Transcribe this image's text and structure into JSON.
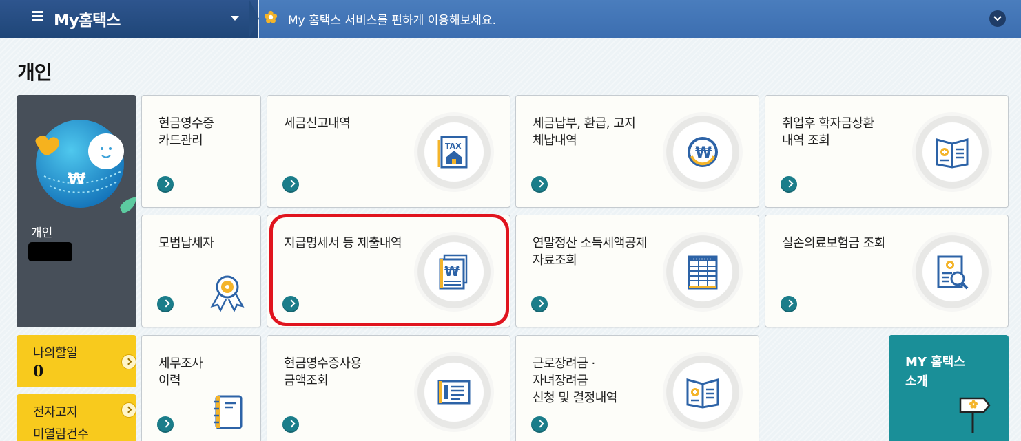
{
  "topbar": {
    "brand": "My홈택스",
    "message": "My 홈택스 서비스를 편하게 이용해보세요."
  },
  "section_title": "개인",
  "profile": {
    "label": "개인"
  },
  "tiles": [
    {
      "label": "현금영수증\n카드관리",
      "icon": "none"
    },
    {
      "label": "세금신고내역",
      "icon": "tax-house-icon"
    },
    {
      "label": "세금납부, 환급, 고지\n체납내역",
      "icon": "won-coin-icon"
    },
    {
      "label": "취업후 학자금상환\n내역 조회",
      "icon": "open-book-icon"
    },
    {
      "label": "모범납세자",
      "icon": "award-ribbon-icon"
    },
    {
      "label": "지급명세서 등 제출내역",
      "icon": "won-documents-icon"
    },
    {
      "label": "연말정산 소득세액공제\n자료조회",
      "icon": "table-document-icon"
    },
    {
      "label": "실손의료보험금 조회",
      "icon": "medical-search-icon"
    },
    {
      "label": "세무조사\n이력",
      "icon": "notebook-icon"
    },
    {
      "label": "현금영수증사용\n금액조회",
      "icon": "receipt-icon"
    },
    {
      "label": "근로장려금 ·\n자녀장려금\n신청 및 결정내역",
      "icon": "leaflet-icon"
    }
  ],
  "side": {
    "todo_label": "나의할일",
    "todo_count": "0",
    "notice_label": "전자고지",
    "notice_label2": "미열람건수"
  },
  "intro": {
    "label": "MY 홈택스\n소개"
  },
  "colors": {
    "highlight": "#e0141e",
    "go_button": "#1b7d8a",
    "yellow": "#f8ca1d",
    "teal": "#1a8f98"
  }
}
